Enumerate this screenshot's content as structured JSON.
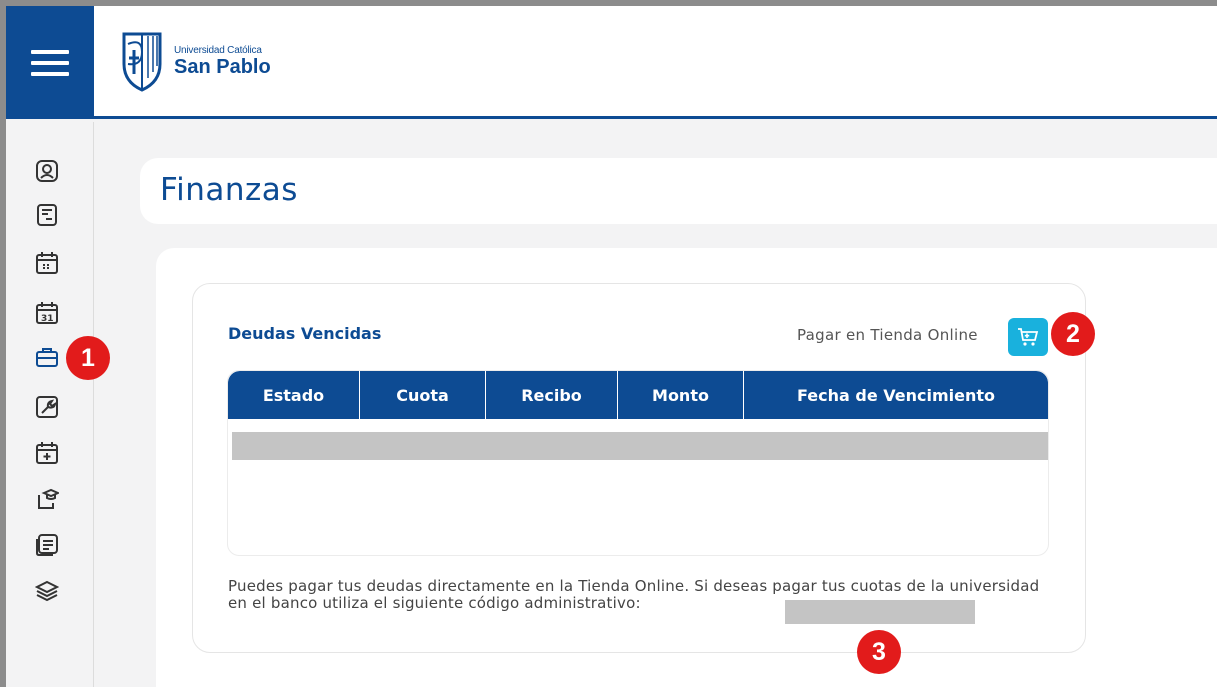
{
  "header": {
    "logo_small": "Universidad Católica",
    "logo_big": "San Pablo"
  },
  "sidebar": {
    "items": [
      {
        "icon": "user-icon"
      },
      {
        "icon": "document-icon"
      },
      {
        "icon": "calendar-icon"
      },
      {
        "icon": "calendar-31-icon"
      },
      {
        "icon": "briefcase-icon",
        "active": true
      },
      {
        "icon": "wrench-icon"
      },
      {
        "icon": "calendar-plus-icon"
      },
      {
        "icon": "graduation-cap-icon"
      },
      {
        "icon": "news-icon"
      },
      {
        "icon": "layers-icon"
      }
    ]
  },
  "page": {
    "title": "Finanzas"
  },
  "debts": {
    "title": "Deudas Vencidas",
    "pay_label": "Pagar en Tienda Online",
    "cart_icon": "cart-icon",
    "columns": [
      "Estado",
      "Cuota",
      "Recibo",
      "Monto",
      "Fecha de Vencimiento"
    ],
    "note": "Puedes pagar tus deudas directamente en la Tienda Online. Si deseas pagar tus cuotas de la universidad en el banco utiliza el siguiente código administrativo:"
  },
  "annotations": {
    "marker_1": "1",
    "marker_2": "2",
    "marker_3": "3"
  },
  "colors": {
    "brand_blue": "#0d4b93",
    "cart_button": "#19b1dd",
    "marker_red": "#e21b1b"
  }
}
